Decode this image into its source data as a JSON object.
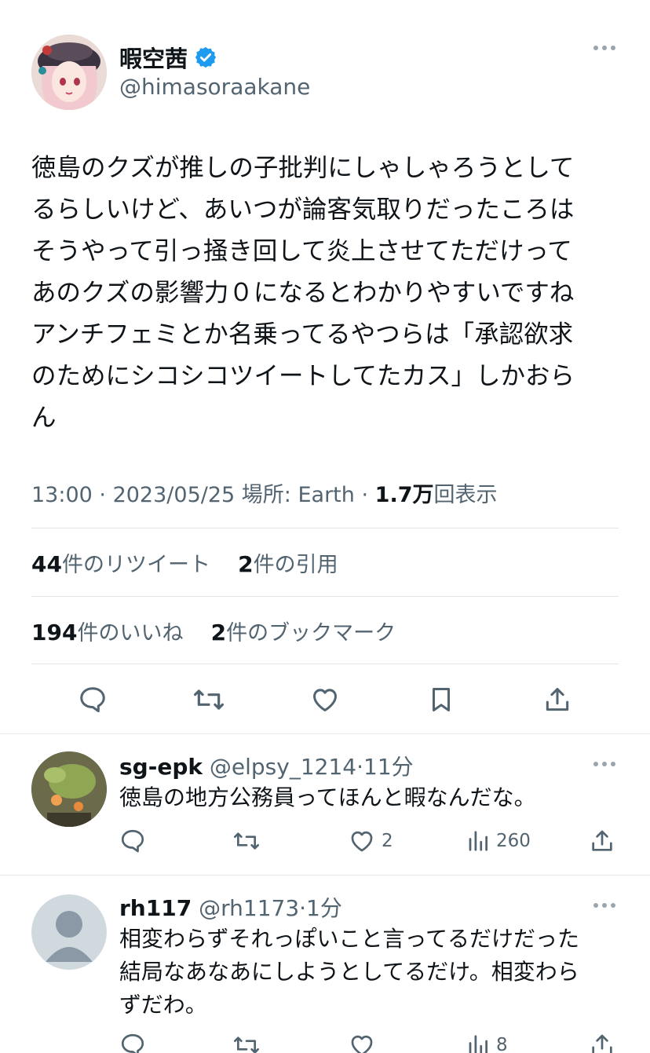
{
  "tweet": {
    "display_name": "暇空茜",
    "handle": "@himasoraakane",
    "text_lines": [
      "徳島のクズが推しの子批判にしゃしゃろうとして",
      "るらしいけど、あいつが論客気取りだったころは",
      "そうやって引っ掻き回して炎上させてただけって",
      "あのクズの影響力０になるとわかりやすいですね",
      "アンチフェミとか名乗ってるやつらは「承認欲求",
      "のためにシコシコツイートしてたカス」しかおら",
      "ん"
    ],
    "time": "13:00",
    "date": "2023/05/25",
    "location": "場所: Earth",
    "views_count": "1.7万",
    "views_label": "回表示",
    "retweets_count": "44",
    "retweets_label": "件のリツイート",
    "quotes_count": "2",
    "quotes_label": "件の引用",
    "likes_count": "194",
    "likes_label": "件のいいね",
    "bookmarks_count": "2",
    "bookmarks_label": "件のブックマーク"
  },
  "replies": [
    {
      "name": "sg-epk",
      "handle": "@elpsy_1214",
      "time": "11分",
      "text_lines": [
        "徳島の地方公務員ってほんと暇なんだな。"
      ],
      "likes": "2",
      "views": "260"
    },
    {
      "name": "rh117",
      "handle": "@rh1173",
      "time": "1分",
      "text_lines": [
        "相変わらずそれっぽいこと言ってるだけだった",
        "結局なあなあにしようとしてるだけ。相変わら",
        "ずだわ。"
      ],
      "likes": "",
      "views": "8"
    }
  ],
  "colors": {
    "accent": "#1d9bf0",
    "muted": "#536471",
    "text": "#0f1419",
    "divider": "#e1e6ea"
  }
}
